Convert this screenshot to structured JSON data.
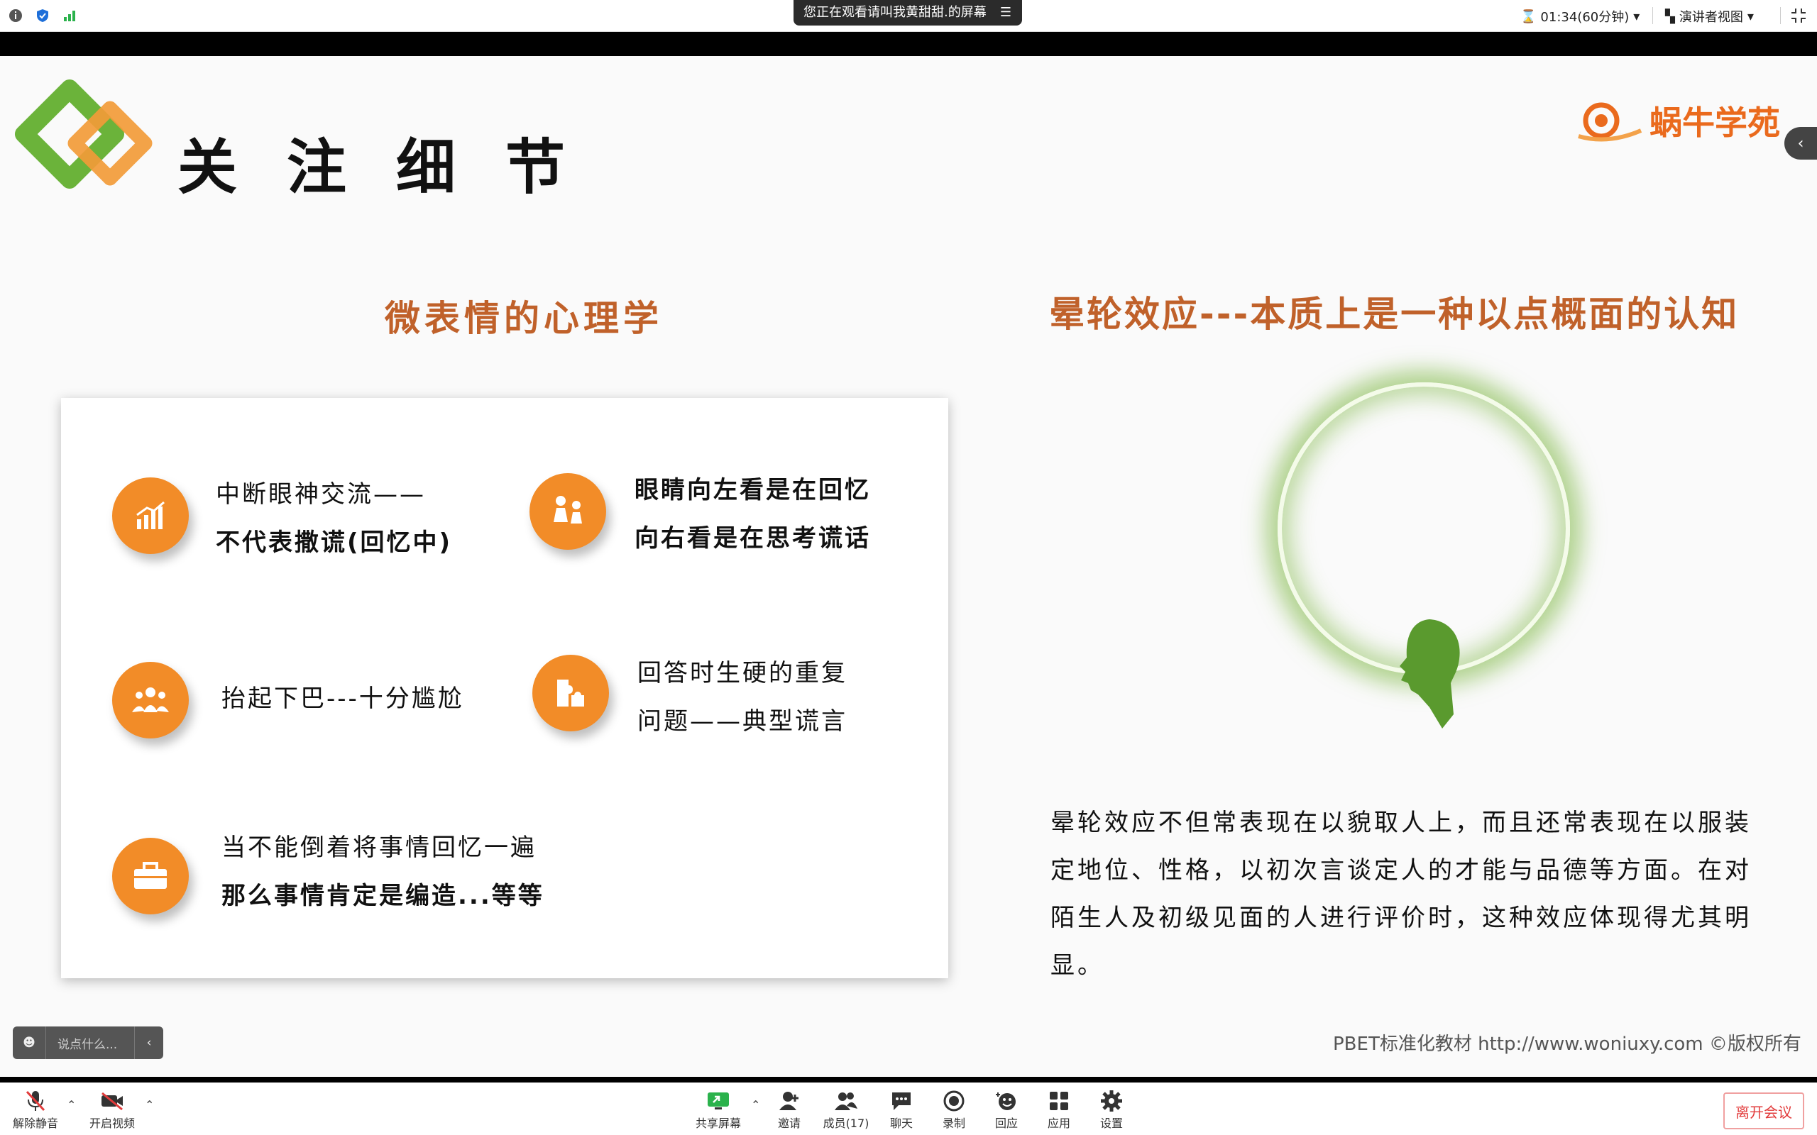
{
  "topbar": {
    "share_notice": "您正在观看请叫我黄甜甜.的屏幕",
    "timer": "01:34(60分钟)",
    "view_mode": "演讲者视图"
  },
  "slide": {
    "title": "关注细节",
    "brand": "蜗牛学苑",
    "left_heading": "微表情的心理学",
    "right_heading": "晕轮效应---本质上是一种以点概面的认知",
    "items": [
      {
        "line1": "中断眼神交流——",
        "line2": "不代表撒谎(回忆中)"
      },
      {
        "line1": "眼睛向左看是在回忆",
        "line2": "向右看是在思考谎话"
      },
      {
        "line1": "抬起下巴---十分尴尬",
        "line2": ""
      },
      {
        "line1": "回答时生硬的重复",
        "line2": "问题——典型谎言"
      },
      {
        "line1": "当不能倒着将事情回忆一遍",
        "line2": "那么事情肯定是编造...等等"
      }
    ],
    "description": "晕轮效应不但常表现在以貌取人上，而且还常表现在以服装定地位、性格，以初次言谈定人的才能与品德等方面。在对陌生人及初级见面的人进行评价时，这种效应体现得尤其明显。",
    "credit": "PBET标准化教材  http://www.woniuxy.com ©版权所有"
  },
  "chat": {
    "placeholder": "说点什么..."
  },
  "toolbar": {
    "unmute": "解除静音",
    "start_video": "开启视频",
    "share_screen": "共享屏幕",
    "invite": "邀请",
    "members": "成员(17)",
    "chat": "聊天",
    "record": "录制",
    "reactions": "回应",
    "apps": "应用",
    "settings": "设置",
    "leave": "离开会议"
  },
  "colors": {
    "accent_orange": "#f28c28",
    "heading_brown": "#c0612a",
    "logo_green": "#6bb33a",
    "leave_red": "#e23b3b"
  }
}
